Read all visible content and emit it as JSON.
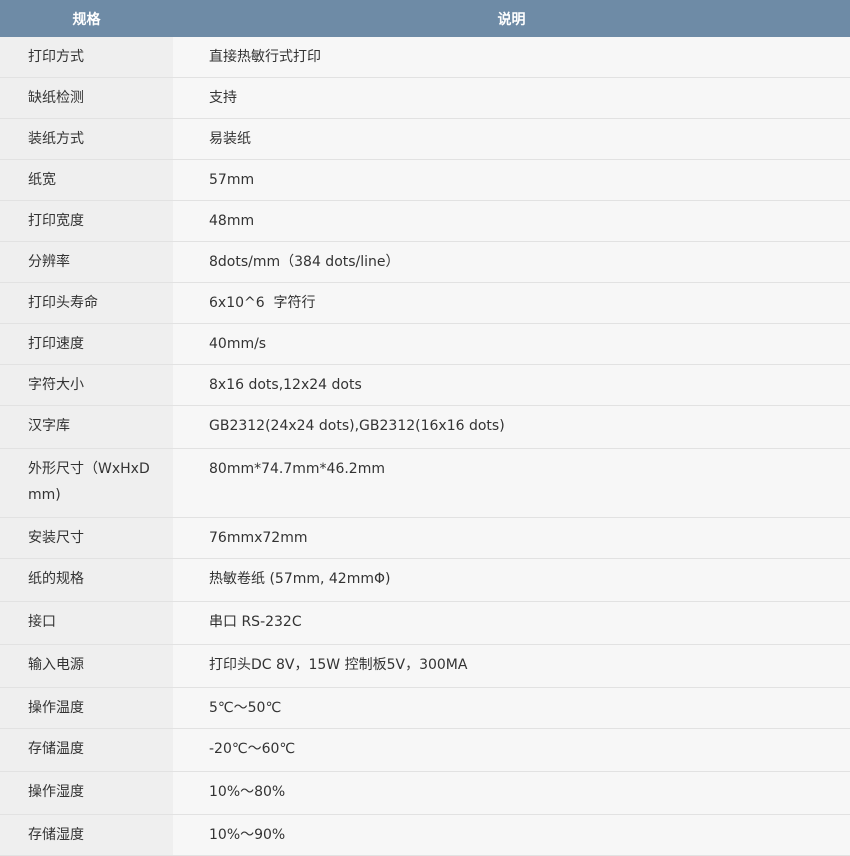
{
  "header": {
    "col1": "规格",
    "col2": "说明"
  },
  "rows": [
    {
      "label": "打印方式",
      "value": "直接热敏行式打印"
    },
    {
      "label": "缺纸检测",
      "value": "支持"
    },
    {
      "label": "装纸方式",
      "value": "易装纸"
    },
    {
      "label": "纸宽",
      "value": "57mm"
    },
    {
      "label": "打印宽度",
      "value": "48mm"
    },
    {
      "label": "分辨率",
      "value": "8dots/mm（384 dots/line）"
    },
    {
      "label": "打印头寿命",
      "value": "6x10^6  字符行"
    },
    {
      "label": "打印速度",
      "value": "40mm/s"
    },
    {
      "label": "字符大小",
      "value": "8x16 dots,12x24 dots"
    },
    {
      "label": "汉字库",
      "value": "GB2312(24x24 dots),GB2312(16x16 dots)"
    },
    {
      "label": "外形尺寸（WxHxD mm)",
      "value": "80mm*74.7mm*46.2mm"
    },
    {
      "label": "安装尺寸",
      "value": "76mmx72mm"
    },
    {
      "label": "纸的规格",
      "value": "热敏卷纸 (57mm, 42mmΦ)"
    },
    {
      "label": "接口",
      "value": "串口 RS-232C"
    },
    {
      "label": "输入电源",
      "value": "打印头DC 8V，15W 控制板5V，300MA"
    },
    {
      "label": "操作温度",
      "value": "5℃～50℃"
    },
    {
      "label": "存储温度",
      "value": "-20℃～60℃"
    },
    {
      "label": "操作湿度",
      "value": "10%～80%"
    },
    {
      "label": "存储湿度",
      "value": "10%～90%"
    }
  ]
}
